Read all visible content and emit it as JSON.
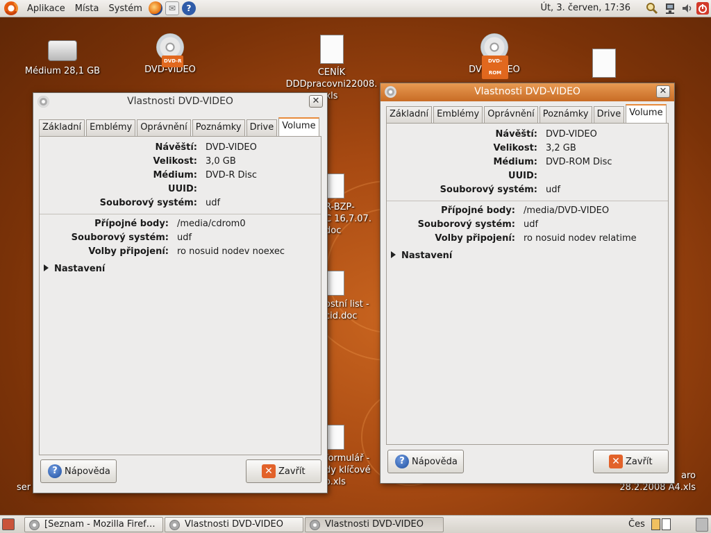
{
  "top_panel": {
    "menus": [
      "Aplikace",
      "Místa",
      "Systém"
    ],
    "clock": "Út,  3. červen, 17:36"
  },
  "desktop_icons": [
    {
      "label": "Médium 28,1 GB",
      "icon": "harddisk-icon"
    },
    {
      "label": "DVD-VIDEO",
      "icon": "dvd-r-icon",
      "badge": "DVD-R"
    },
    {
      "label": "CENÍK DDDpracovni22008.xls",
      "line1": "CENÍK",
      "line2": "DDDpracovni22008.",
      "line3": "xls",
      "icon": "spreadsheet-icon"
    },
    {
      "label": "DVD-VIDEO",
      "icon": "dvd-rom-icon",
      "badge": "DVD-ROM"
    },
    {
      "label": "",
      "icon": "image-document-icon"
    }
  ],
  "partial_desktop_labels": {
    "a": [
      "R-BZP-",
      "C 16,7.07.",
      "doc"
    ],
    "b": [
      "ostní list -",
      "cid.doc"
    ],
    "c": [
      "formulář -",
      "dy klíčové",
      "o.xls"
    ],
    "d": [
      "aro",
      "28.2.2008  A4.xls"
    ],
    "e": "ser"
  },
  "dialogs": [
    {
      "title": "Vlastnosti DVD-VIDEO",
      "tabs": [
        "Základní",
        "Emblémy",
        "Oprávnění",
        "Poznámky",
        "Drive",
        "Volume"
      ],
      "active_tab": "Volume",
      "fields": [
        {
          "label": "Návěští:",
          "value": "DVD-VIDEO"
        },
        {
          "label": "Velikost:",
          "value": "3,0 GB"
        },
        {
          "label": "Médium:",
          "value": "DVD-R Disc"
        },
        {
          "label": "UUID:",
          "value": ""
        },
        {
          "label": "Souborový systém:",
          "value": "udf"
        }
      ],
      "mount_fields": [
        {
          "label": "Přípojné body:",
          "value": "/media/cdrom0"
        },
        {
          "label": "Souborový systém:",
          "value": "udf"
        },
        {
          "label": "Volby připojení:",
          "value": "ro nosuid nodev noexec"
        }
      ],
      "expander": "Nastavení",
      "help_button": "Nápověda",
      "close_button": "Zavřít"
    },
    {
      "title": "Vlastnosti DVD-VIDEO",
      "tabs": [
        "Základní",
        "Emblémy",
        "Oprávnění",
        "Poznámky",
        "Drive",
        "Volume"
      ],
      "active_tab": "Volume",
      "fields": [
        {
          "label": "Návěští:",
          "value": "DVD-VIDEO"
        },
        {
          "label": "Velikost:",
          "value": "3,2 GB"
        },
        {
          "label": "Médium:",
          "value": "DVD-ROM Disc"
        },
        {
          "label": "UUID:",
          "value": ""
        },
        {
          "label": "Souborový systém:",
          "value": "udf"
        }
      ],
      "mount_fields": [
        {
          "label": "Přípojné body:",
          "value": "/media/DVD-VIDEO"
        },
        {
          "label": "Souborový systém:",
          "value": "udf"
        },
        {
          "label": "Volby připojení:",
          "value": "ro nosuid nodev relatime"
        }
      ],
      "expander": "Nastavení",
      "help_button": "Nápověda",
      "close_button": "Zavřít"
    }
  ],
  "taskbar": {
    "tasks": [
      "[Seznam - Mozilla Firef…",
      "Vlastnosti DVD-VIDEO",
      "Vlastnosti DVD-VIDEO"
    ],
    "keyboard_layout": "Čes"
  }
}
